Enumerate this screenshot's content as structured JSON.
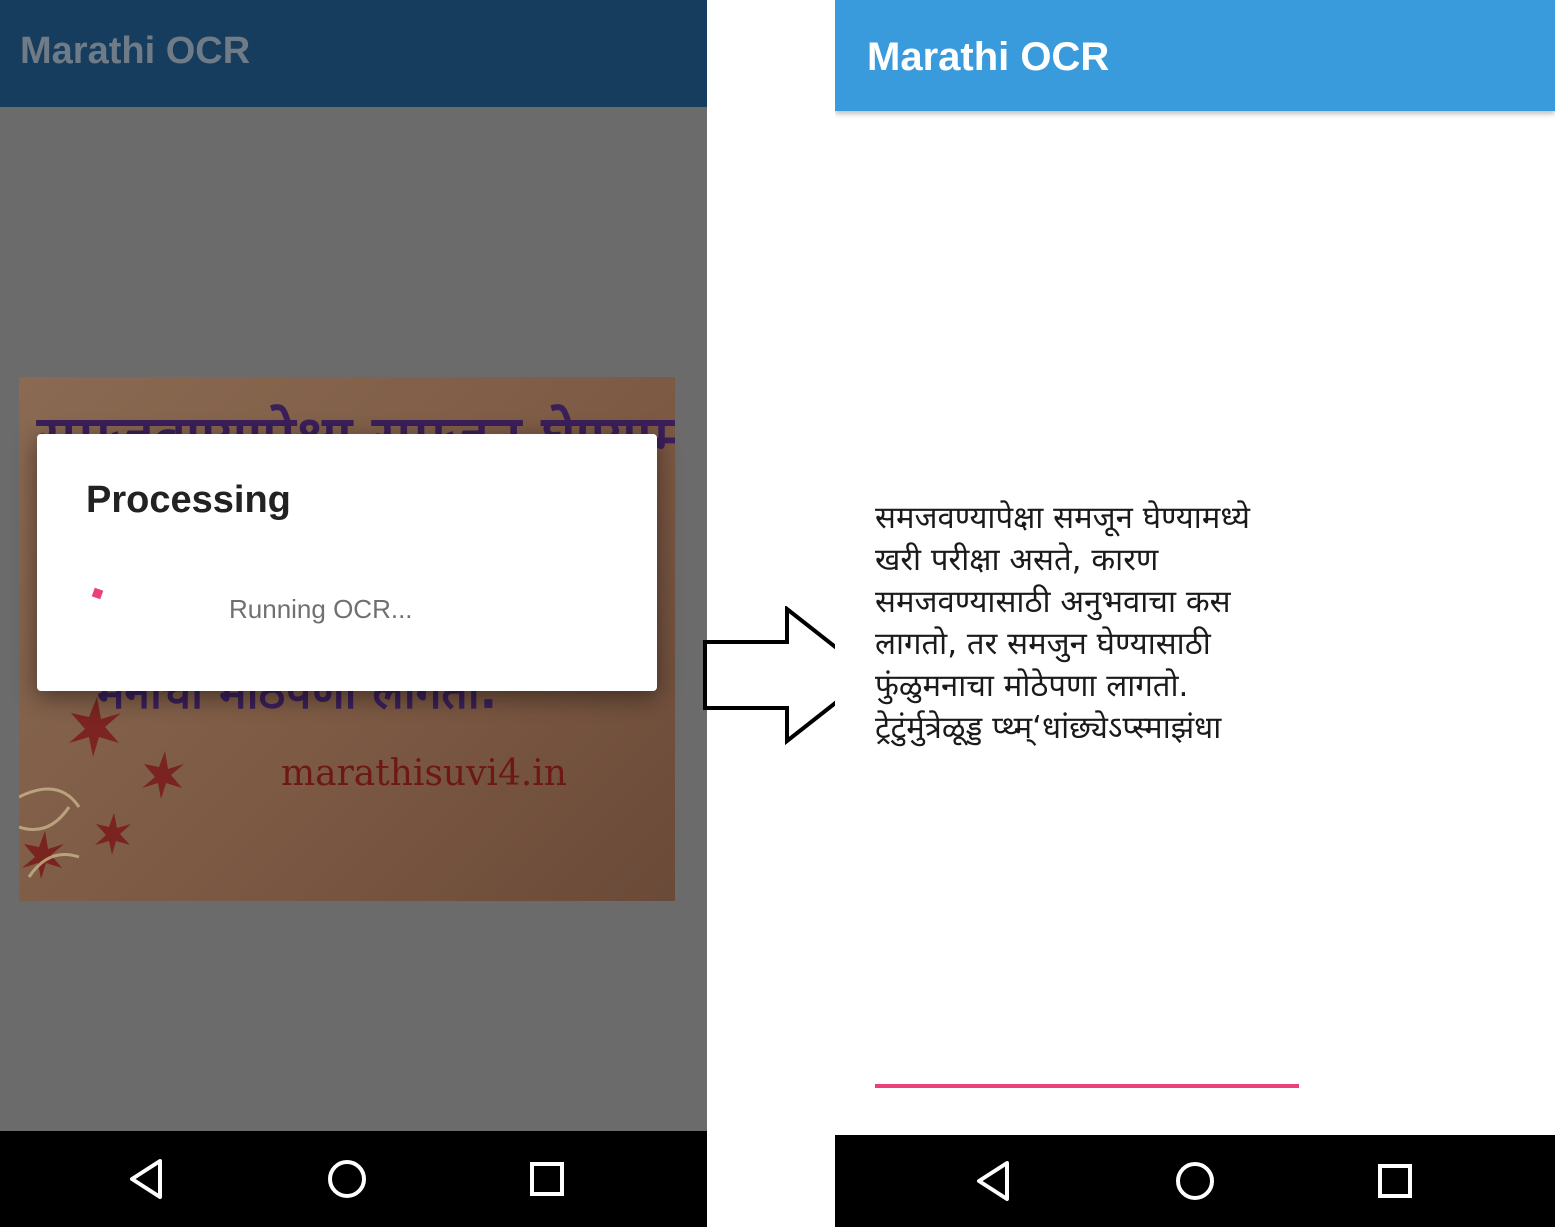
{
  "left_screen": {
    "app_title": "Marathi OCR",
    "source_image": {
      "line_top": "समजवण्यापेक्षा समजून घेण्यामध्ये",
      "line_bottom": "मनाचा मोठेपणा लागतो.",
      "watermark": "marathisuvi4.in"
    },
    "dialog": {
      "title": "Processing",
      "message": "Running OCR..."
    },
    "navbar": [
      "back-icon",
      "home-icon",
      "recents-icon"
    ]
  },
  "right_screen": {
    "app_title": "Marathi OCR",
    "ocr_text_lines": [
      "समजवण्यापेक्षा समजून घेण्यामध्ये",
      "खरी परीक्षा असते, कारण",
      "समजवण्यासाठी अनुभवाचा कस",
      "लागतो, तर समजुन घेण्यासाठी",
      "फुंळुमनाचा मोठेपणा लागतो.",
      "ट्रेटुंर्मुत्रेळूड्ड प्थ्म्‘धांछ्येऽप्स्माझंधा"
    ],
    "navbar": [
      "back-icon",
      "home-icon",
      "recents-icon"
    ]
  },
  "colors": {
    "left_appbar": "#163d5d",
    "right_appbar": "#3a9bdc",
    "accent": "#ec407a",
    "scrim": "#6b6b6b"
  }
}
